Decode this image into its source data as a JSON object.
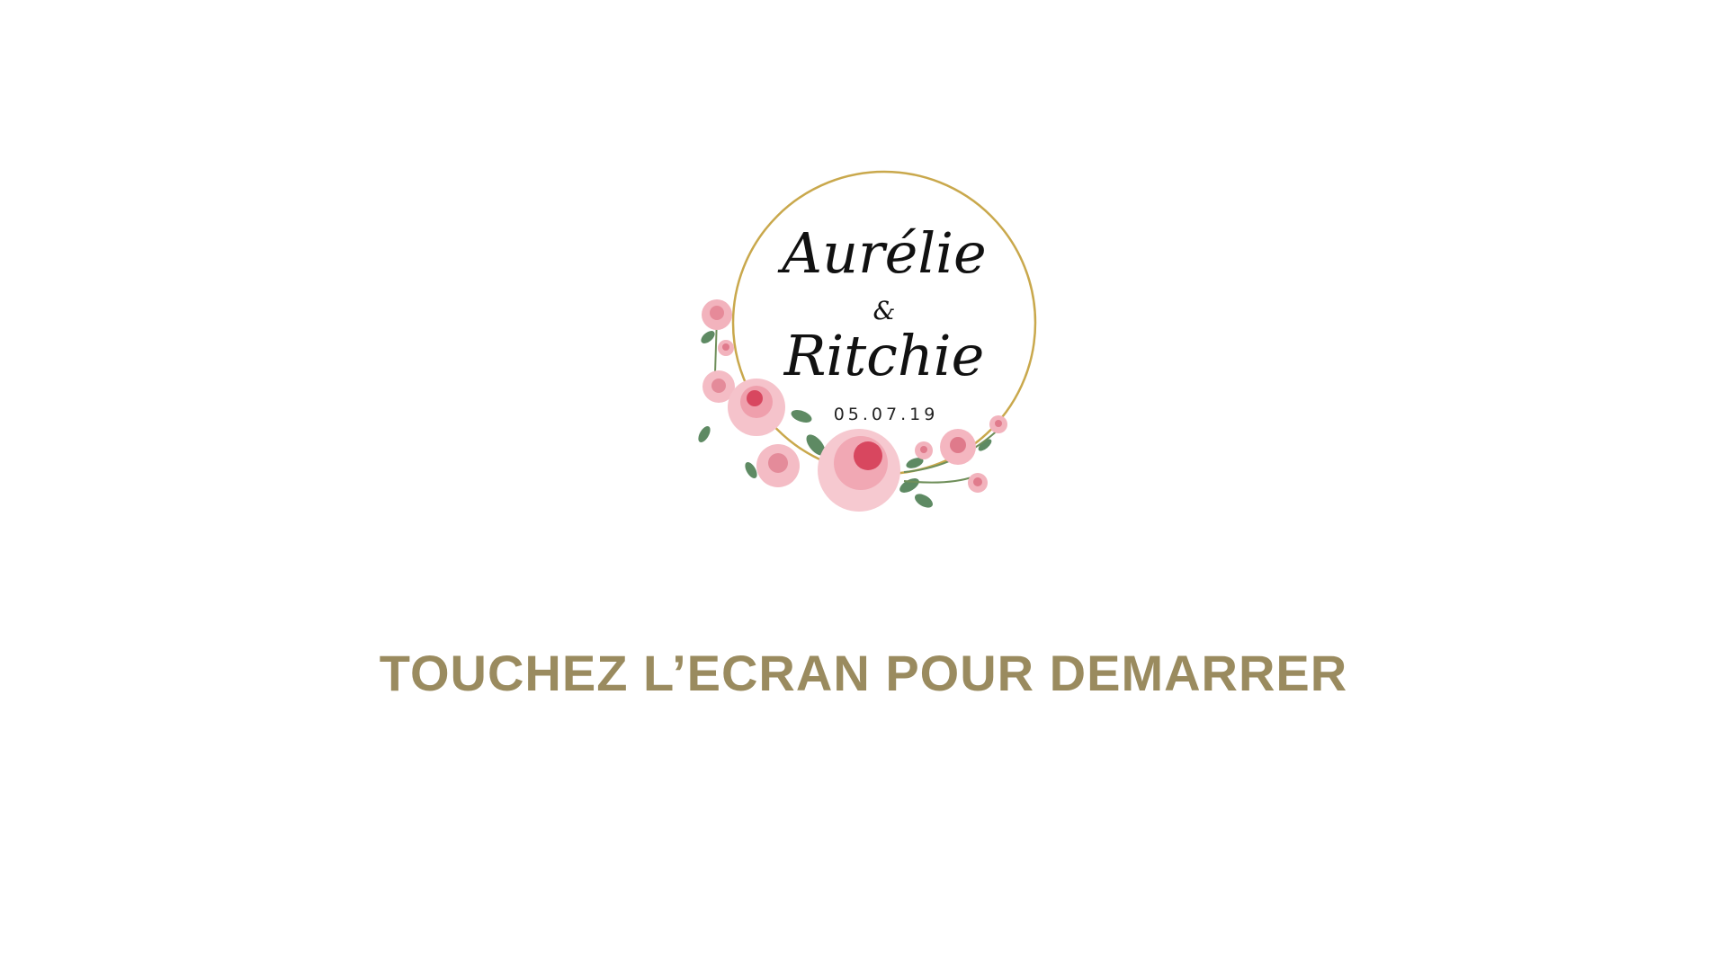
{
  "logo": {
    "name_1": "Aurélie",
    "ampersand": "&",
    "name_2": "Ritchie",
    "date": "05.07.19"
  },
  "cta": {
    "label": "TOUCHEZ L’ECRAN POUR DEMARRER"
  },
  "colors": {
    "background": "#ffffff",
    "cta_text": "#9a8b5f",
    "ring_gold": "#c9a84c",
    "rose_pink": "#f2b3bd",
    "rose_deep": "#d8475f",
    "leaf_green": "#5e8a63"
  }
}
